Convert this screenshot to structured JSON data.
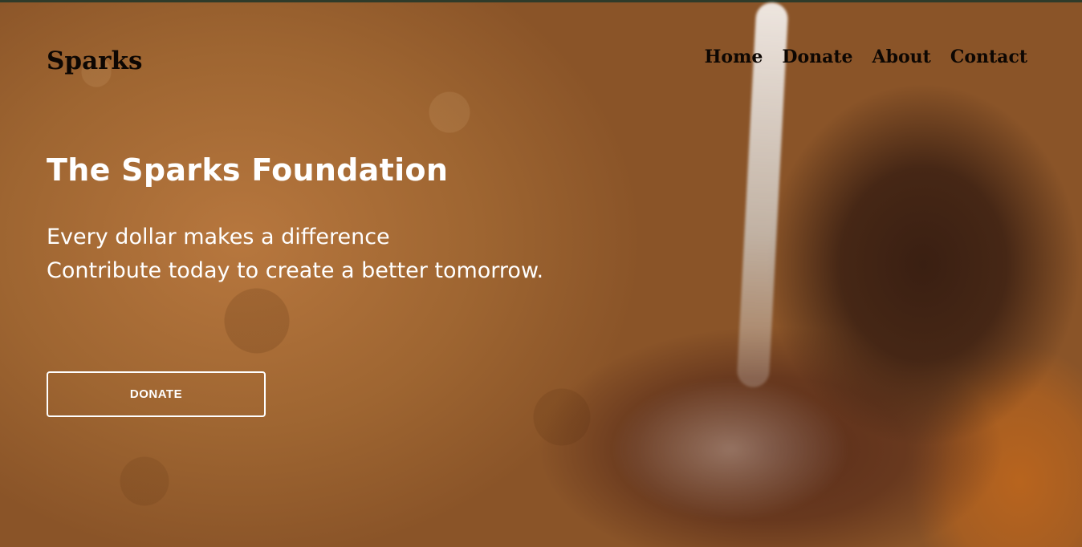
{
  "header": {
    "logo": "Sparks",
    "nav": {
      "home": "Home",
      "donate": "Donate",
      "about": "About",
      "contact": "Contact"
    }
  },
  "hero": {
    "title": "The Sparks Foundation",
    "line1": "Every dollar makes a difference",
    "line2": "Contribute today to create a better tomorrow.",
    "button": "DONATE",
    "background_image": "child-catching-water-photo"
  },
  "colors": {
    "nav_text": "#0d0703",
    "hero_text": "#ffffff",
    "button_border": "#ffffff",
    "background": "#9a612f"
  }
}
